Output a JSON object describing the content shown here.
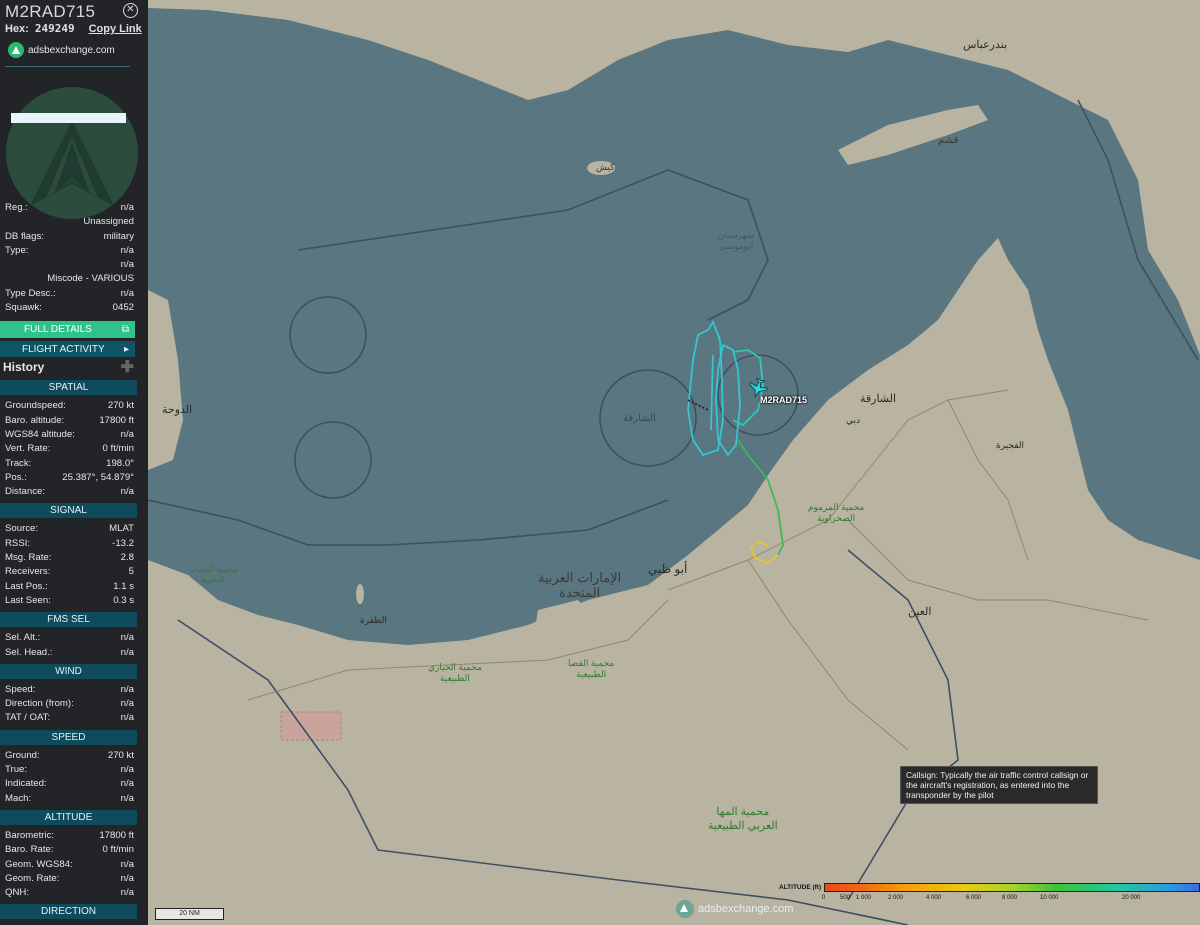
{
  "aircraft": {
    "callsign": "M2RAD715",
    "hex_label": "Hex:",
    "hex": "249249",
    "copy_link": "Copy Link",
    "brand": "adsbexchange.com"
  },
  "info": {
    "reg_label": "Reg.:",
    "reg": "n/a",
    "owner": "Unassigned",
    "dbflags_label": "DB flags:",
    "dbflags": "military",
    "type_label": "Type:",
    "type": "n/a",
    "type2": "n/a",
    "miscode": "Miscode - VARIOUS",
    "typedesc_label": "Type Desc.:",
    "typedesc": "n/a",
    "squawk_label": "Squawk:",
    "squawk": "0452"
  },
  "buttons": {
    "full_details": "FULL DETAILS",
    "flight_activity": "FLIGHT ACTIVITY",
    "history": "History"
  },
  "spatial": {
    "title": "SPATIAL",
    "rows": [
      {
        "k": "Groundspeed:",
        "v": "270 kt"
      },
      {
        "k": "Baro. altitude:",
        "v": "17800 ft"
      },
      {
        "k": "WGS84 altitude:",
        "v": "n/a"
      },
      {
        "k": "Vert. Rate:",
        "v": "0 ft/min"
      },
      {
        "k": "Track:",
        "v": "198.0°"
      },
      {
        "k": "Pos.:",
        "v": "25.387°, 54.879°"
      },
      {
        "k": "Distance:",
        "v": "n/a"
      }
    ]
  },
  "signal": {
    "title": "SIGNAL",
    "rows": [
      {
        "k": "Source:",
        "v": "MLAT"
      },
      {
        "k": "RSSI:",
        "v": "-13.2"
      },
      {
        "k": "Msg. Rate:",
        "v": "2.8"
      },
      {
        "k": "Receivers:",
        "v": "5"
      },
      {
        "k": "Last Pos.:",
        "v": "1.1 s"
      },
      {
        "k": "Last Seen:",
        "v": "0.3 s"
      }
    ]
  },
  "fms": {
    "title": "FMS SEL",
    "rows": [
      {
        "k": "Sel. Alt.:",
        "v": "n/a"
      },
      {
        "k": "Sel. Head.:",
        "v": "n/a"
      }
    ]
  },
  "wind": {
    "title": "WIND",
    "rows": [
      {
        "k": "Speed:",
        "v": "n/a"
      },
      {
        "k": "Direction (from):",
        "v": "n/a"
      },
      {
        "k": "TAT / OAT:",
        "v": "n/a"
      }
    ]
  },
  "speed": {
    "title": "SPEED",
    "rows": [
      {
        "k": "Ground:",
        "v": "270 kt"
      },
      {
        "k": "True:",
        "v": "n/a"
      },
      {
        "k": "Indicated:",
        "v": "n/a"
      },
      {
        "k": "Mach:",
        "v": "n/a"
      }
    ]
  },
  "altitude": {
    "title": "ALTITUDE",
    "rows": [
      {
        "k": "Barometric:",
        "v": "17800 ft"
      },
      {
        "k": "Baro. Rate:",
        "v": "0 ft/min"
      },
      {
        "k": "Geom. WGS84:",
        "v": "n/a"
      },
      {
        "k": "Geom. Rate:",
        "v": "n/a"
      },
      {
        "k": "QNH:",
        "v": "n/a"
      }
    ]
  },
  "direction": {
    "title": "DIRECTION"
  },
  "map": {
    "aircraft_label": "M2RAD715",
    "tooltip": "Callsign: Typically the air traffic control callsign or the aircraft's registration, as entered into the transponder by the pilot",
    "scale": "20 NM",
    "watermark": "adsbexchange.com",
    "labels": {
      "uae": "الإمارات العربية",
      "uae2": "المتحدة",
      "abudhabi": "أبو ظبي",
      "sharjah": "الشارقة",
      "sharjah_sea": "الشارقة",
      "dubai": "دبي",
      "doha": "الدوحة",
      "bandar_abbas": "بندرعباس",
      "qeshm": "قشم",
      "kish": "كيش",
      "alain": "العين",
      "fujairah": "الفجيرة",
      "reserve1": "محمية المها",
      "reserve1b": "العربي الطبيعية",
      "reserve2": "محمية المرموم",
      "reserve2b": "الصحراوية",
      "reserve3": "محمية الحباري",
      "reserve3b": "الطبيعية",
      "reserve4": "محمية القضا",
      "reserve4b": "الطبيعية",
      "reserve5": "محمية الياسات",
      "reserve5b": "البحرية",
      "abumusa": "شهرستان",
      "abumusa2": "ابوموسی",
      "dhafra": "الظفرة"
    },
    "colors": {
      "water": "#5a7680",
      "land": "#b9b4a2",
      "track_cyan": "#34c7d3",
      "track_green": "#3cb85a",
      "track_yellow": "#e6c531",
      "plane": "#33d2e0"
    }
  },
  "legend": {
    "title": "ALTITUDE (ft)",
    "ticks": [
      "0",
      "500",
      "1 000",
      "2 000",
      "4 000",
      "6 000",
      "8 000",
      "10 000",
      "20 000"
    ]
  }
}
